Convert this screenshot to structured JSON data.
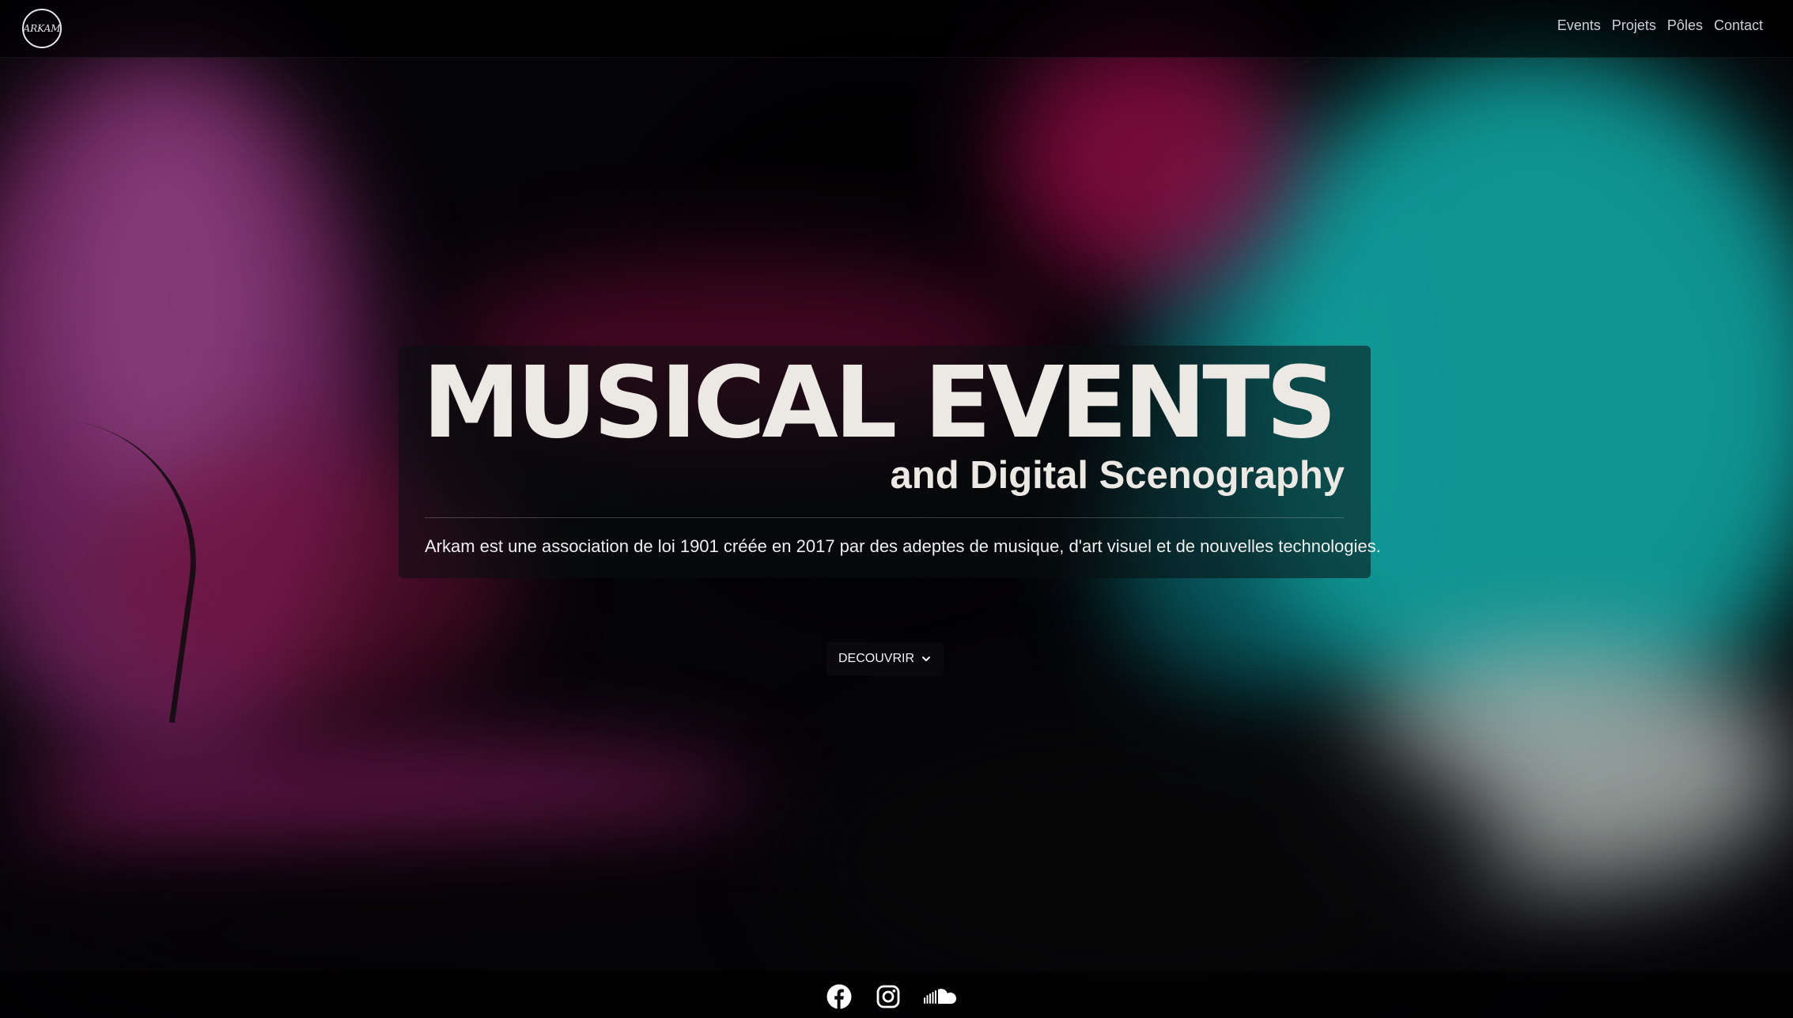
{
  "brand": {
    "logo_text": "ARKAM"
  },
  "nav": {
    "items": [
      {
        "label": "Events"
      },
      {
        "label": "Projets"
      },
      {
        "label": "Pôles"
      },
      {
        "label": "Contact"
      }
    ]
  },
  "hero": {
    "title": "MUSICAL EVENTS",
    "subtitle": "and Digital Scenography",
    "description": "Arkam est une association de loi 1901 créée en 2017 par des adeptes de musique, d'art visuel et de nouvelles technologies."
  },
  "cta": {
    "label": "DECOUVRIR",
    "icon": "chevron-down-icon"
  },
  "social": {
    "icons": [
      "facebook-icon",
      "instagram-icon",
      "soundcloud-icon"
    ]
  },
  "colors": {
    "text_light": "#ece8e3",
    "nav_text": "#c9d2d6",
    "accent_cyan": "#16d8d5",
    "accent_magenta": "#c0105c"
  }
}
